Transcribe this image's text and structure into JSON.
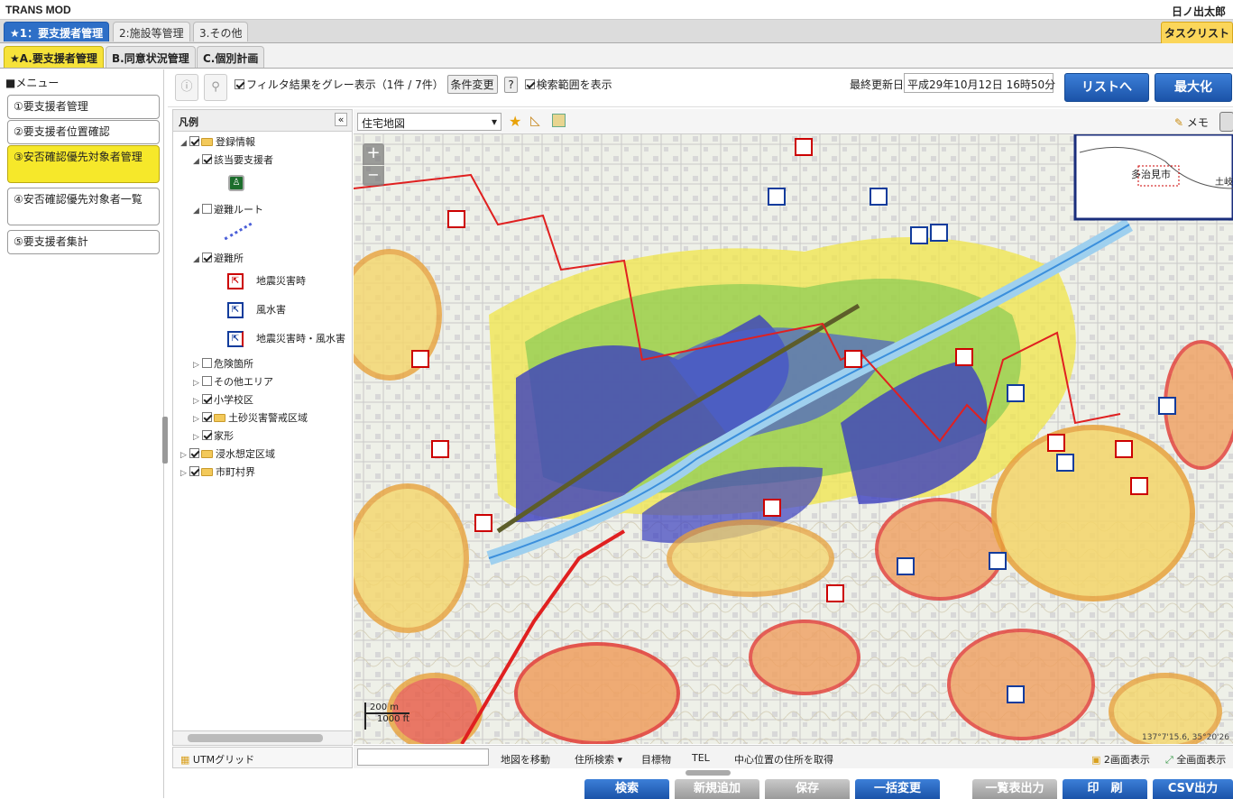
{
  "app": {
    "title": "TRANS MOD",
    "user": "日ノ出太郎",
    "tasklist": "タスクリスト"
  },
  "tabs": [
    {
      "label": "★1：要支援者管理",
      "active": true
    },
    {
      "label": "2:施設等管理",
      "active": false
    },
    {
      "label": "3.その他",
      "active": false
    }
  ],
  "subtabs": [
    {
      "label": "★A.要支援者管理",
      "active": true
    },
    {
      "label": "B.同意状況管理",
      "active": false
    },
    {
      "label": "C.個別計画",
      "active": false
    }
  ],
  "menu": {
    "title": "■メニュー",
    "items": [
      {
        "label": "①要支援者管理"
      },
      {
        "label": "②要支援者位置確認"
      },
      {
        "label": "③安否確認優先対象者管理",
        "active": true
      },
      {
        "label": "④安否確認優先対象者一覧"
      },
      {
        "label": "⑤要支援者集計"
      }
    ]
  },
  "toolbar": {
    "filter_gray": "フィルタ結果をグレー表示（1件 / 7件）",
    "condition_change": "条件変更",
    "help": "?",
    "show_search_range": "検索範囲を表示",
    "last_updated_label": "最終更新日",
    "last_updated_value": "平成29年10月12日 16時50分",
    "to_list": "リストへ",
    "maximize": "最大化"
  },
  "legend": {
    "title": "凡例",
    "collapse": "«",
    "items": {
      "registration": "登録情報",
      "target_person": "該当要支援者",
      "evac_route": "避難ルート",
      "shelter": "避難所",
      "shelter_quake": "地震災害時",
      "shelter_flood": "風水害",
      "shelter_both": "地震災害時・風水害",
      "danger": "危険箇所",
      "other_area": "その他エリア",
      "school": "小学校区",
      "landslide": "土砂災害警戒区域",
      "terrain": "家形",
      "flood_area": "浸水想定区域",
      "municipal": "市町村界"
    },
    "utm": "UTMグリッド"
  },
  "map": {
    "layer": "住宅地図",
    "memo": "メモ",
    "zoom_in": "+",
    "zoom_out": "−",
    "overview_city": "多治見市",
    "overview_city2": "土岐",
    "scale_m": "200 m",
    "scale_ft": "1000 ft",
    "coords": "137°7'15.6, 35°20'26"
  },
  "mapbar": {
    "move": "地図を移動",
    "address_search": "住所検索 ▾",
    "landmark": "目標物",
    "tel": "TEL",
    "center_address": "中心位置の住所を取得",
    "two_screen": "2画面表示",
    "fullscreen": "全画面表示"
  },
  "actions": {
    "search": "検索",
    "add": "新規追加",
    "save": "保存",
    "bulk_change": "一括変更",
    "export_list": "一覧表出力",
    "print": "印　刷",
    "csv": "CSV出力"
  },
  "colors": {
    "tab_active": "#2e6fc7",
    "menu_active": "#f6e82a",
    "flood_blue": "#3b3fbf",
    "landslide_yellow": "#f5d66a",
    "landslide_red": "#e23a33"
  }
}
